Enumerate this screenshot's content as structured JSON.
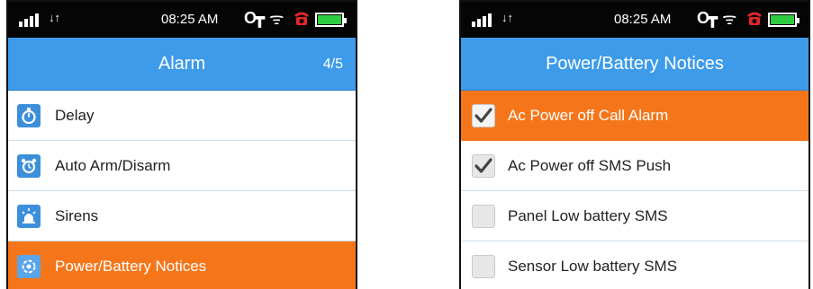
{
  "left_screen": {
    "status": {
      "time": "08:25 AM"
    },
    "title": "Alarm",
    "pager": "4/5",
    "items": [
      {
        "label": "Delay",
        "icon": "stopwatch-icon",
        "active": false
      },
      {
        "label": "Auto Arm/Disarm",
        "icon": "alarm-clock-icon",
        "active": false
      },
      {
        "label": "Sirens",
        "icon": "siren-icon",
        "active": false
      },
      {
        "label": "Power/Battery Notices",
        "icon": "power-settings-icon",
        "active": true
      }
    ]
  },
  "right_screen": {
    "status": {
      "time": "08:25 AM"
    },
    "title": "Power/Battery Notices",
    "items": [
      {
        "label": "Ac Power off Call Alarm",
        "checked": true,
        "active": true
      },
      {
        "label": "Ac Power off SMS Push",
        "checked": true,
        "active": false
      },
      {
        "label": "Panel Low battery SMS",
        "checked": false,
        "active": false
      },
      {
        "label": "Sensor Low battery SMS",
        "checked": false,
        "active": false
      }
    ]
  },
  "colors": {
    "header_blue": "#3d9be9",
    "active_orange": "#f5761a",
    "status_black": "#050505",
    "battery_green": "#2ecc40",
    "alarm_red": "#e8242b"
  }
}
